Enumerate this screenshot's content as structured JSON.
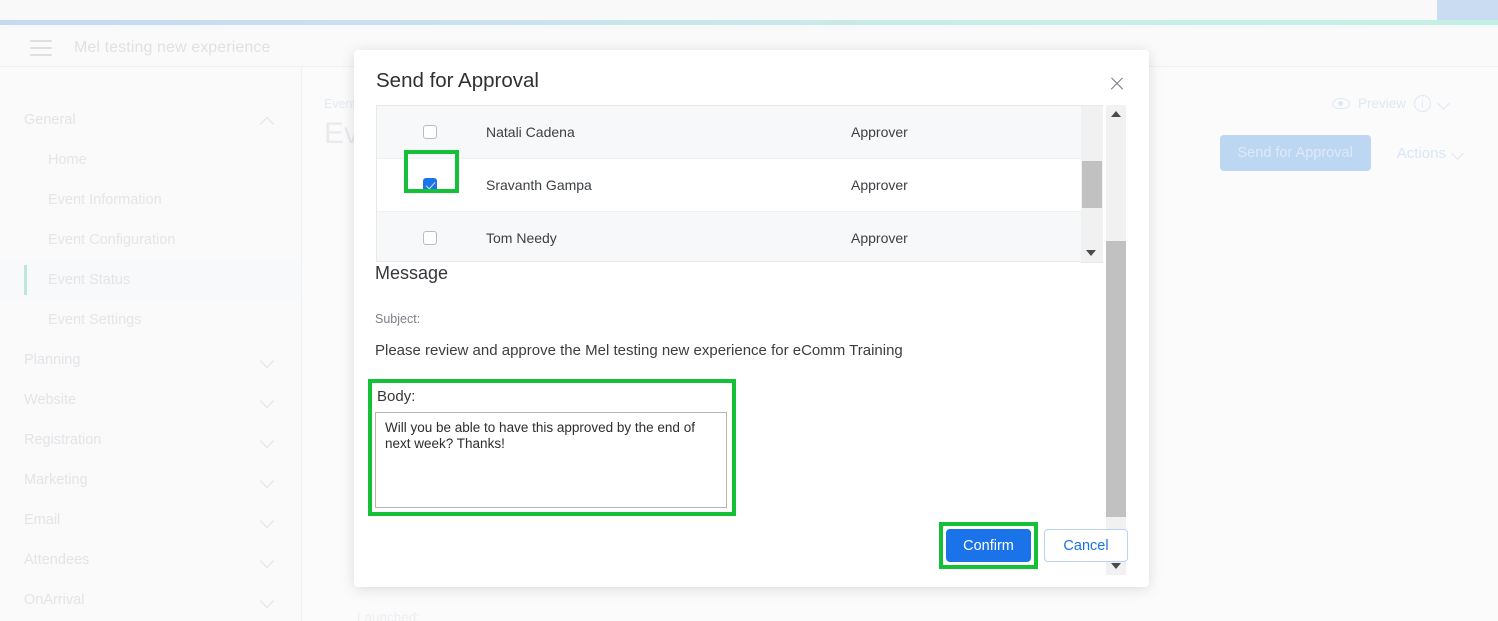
{
  "app": {
    "menu_icon": "hamburger-menu-icon",
    "title": "Mel testing new experience"
  },
  "sidebar": {
    "groups": [
      {
        "label": "General",
        "expanded": true,
        "chevron": "chevron-up-icon",
        "items": [
          {
            "label": "Home",
            "active": false
          },
          {
            "label": "Event Information",
            "active": false
          },
          {
            "label": "Event Configuration",
            "active": false
          },
          {
            "label": "Event Status",
            "active": true
          },
          {
            "label": "Event Settings",
            "active": false
          }
        ]
      },
      {
        "label": "Planning",
        "expanded": false,
        "chevron": "chevron-down-icon",
        "items": []
      },
      {
        "label": "Website",
        "expanded": false,
        "chevron": "chevron-down-icon",
        "items": []
      },
      {
        "label": "Registration",
        "expanded": false,
        "chevron": "chevron-down-icon",
        "items": []
      },
      {
        "label": "Marketing",
        "expanded": false,
        "chevron": "chevron-down-icon",
        "items": []
      },
      {
        "label": "Email",
        "expanded": false,
        "chevron": "chevron-down-icon",
        "items": []
      },
      {
        "label": "Attendees",
        "expanded": false,
        "chevron": "chevron-down-icon",
        "items": []
      },
      {
        "label": "OnArrival",
        "expanded": false,
        "chevron": "chevron-down-icon",
        "items": []
      }
    ]
  },
  "main": {
    "breadcrumb": "Event",
    "page_title": "Ev",
    "preview_label": "Preview",
    "preview_icon": "eye-icon",
    "info_icon": "info-circle-icon",
    "preview_chevron": "chevron-down-icon",
    "send_for_approval_label": "Send for Approval",
    "actions_label": "Actions",
    "actions_chevron": "chevron-down-icon",
    "launched_label": "Launched:"
  },
  "modal": {
    "title": "Send for Approval",
    "close_icon": "close-x-icon",
    "approvers": [
      {
        "name": "Natali Cadena",
        "role": "Approver",
        "checked": false,
        "shaded": true
      },
      {
        "name": "Sravanth Gampa",
        "role": "Approver",
        "checked": true,
        "shaded": false
      },
      {
        "name": "Tom Needy",
        "role": "Approver",
        "checked": false,
        "shaded": true
      }
    ],
    "message_heading": "Message",
    "subject_label": "Subject:",
    "subject_text": "Please review and approve the Mel testing new experience for eComm Training",
    "body_label": "Body:",
    "body_value": "Will you be able to have this approved by the end of next week? Thanks!",
    "confirm_label": "Confirm",
    "cancel_label": "Cancel",
    "scroll_up_icon": "scroll-arrow-up-icon",
    "scroll_down_icon": "scroll-arrow-down-icon"
  },
  "colors": {
    "accent_blue": "#1a73e8",
    "highlight_green": "#14c038",
    "disabled_blue": "#bdd6f2",
    "active_nav": "#bfe6d8"
  }
}
